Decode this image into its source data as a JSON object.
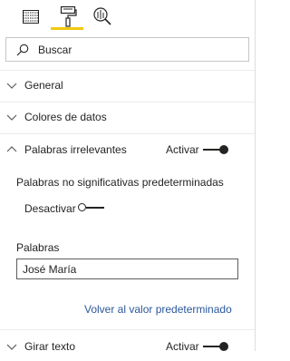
{
  "tabs": [
    {
      "name": "fields",
      "icon": "table-grid-icon"
    },
    {
      "name": "format",
      "icon": "paint-roller-icon",
      "active": true
    },
    {
      "name": "analytics",
      "icon": "analytics-magnifier-icon"
    }
  ],
  "search": {
    "placeholder": "Buscar"
  },
  "sections": {
    "general": {
      "label": "General"
    },
    "data_colors": {
      "label": "Colores de datos"
    },
    "stop_words": {
      "label": "Palabras irrelevantes",
      "toggle_label": "Activar"
    },
    "rotate_text": {
      "label": "Girar texto",
      "toggle_label": "Activar"
    }
  },
  "stop_words_body": {
    "default_label": "Palabras no significativas predeterminadas",
    "default_toggle_label": "Desactivar",
    "words_label": "Palabras",
    "words_value": "José María",
    "revert_link": "Volver al valor predeterminado"
  },
  "colors": {
    "accent": "#f2c811",
    "link": "#2b579a",
    "text": "#252423"
  }
}
